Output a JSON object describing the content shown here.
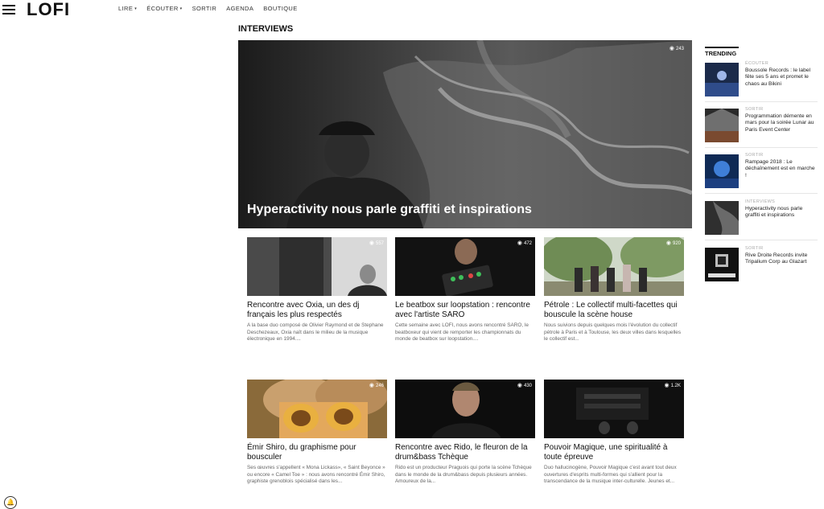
{
  "header": {
    "logo": "LOFI",
    "nav": [
      {
        "label": "LIRE",
        "has_dropdown": true
      },
      {
        "label": "ÉCOUTER",
        "has_dropdown": true
      },
      {
        "label": "SORTIR",
        "has_dropdown": false
      },
      {
        "label": "AGENDA",
        "has_dropdown": false
      },
      {
        "label": "BOUTIQUE",
        "has_dropdown": false
      }
    ],
    "caret": "▾"
  },
  "section_title": "INTERVIEWS",
  "hero": {
    "title": "Hyperactivity nous parle graffiti et inspirations",
    "views": "243"
  },
  "cards": [
    {
      "title": "Rencontre avec Oxia, un des dj français les plus respectés",
      "excerpt": "A la base duo composé de Olivier Raymond et de Stephane Deschezeaux, Oxia naît dans le milieu de la musique électronique en 1994....",
      "views": "557"
    },
    {
      "title": "Le beatbox sur loopstation : rencontre avec l'artiste SARO",
      "excerpt": "Cette semaine avec LOFI, nous avons rencontré SARO, le beatboxeur qui vient de remporter les championnats du monde de beatbox sur loopstation....",
      "views": "472"
    },
    {
      "title": "Pétrole : Le collectif multi-facettes qui bouscule la scène house",
      "excerpt": "Nous suivions depuis quelques mois l'évolution du collectif pétrole à Paris et à Toulouse, les deux villes dans lesquelles le collectif est...",
      "views": "920"
    },
    {
      "title": "Émir Shiro, du graphisme pour bousculer",
      "excerpt": "Ses œuvres s'appellent « Mona Lickass», « Saint Beyonce » ou encore « Camel Toe » : nous avons rencontré Émir Shiro, graphiste grenoblois spécialisé dans les...",
      "views": "246"
    },
    {
      "title": "Rencontre avec Rido, le fleuron de la drum&bass Tchèque",
      "excerpt": "Rido est un producteur Praguois qui porte la scène Tchèque dans le monde de la drum&bass depuis plusieurs années. Amoureux de la...",
      "views": "430"
    },
    {
      "title": "Pouvoir Magique, une spiritualité à toute épreuve",
      "excerpt": "Duo hallucinogène, Pouvoir Magique c'est avant tout deux ouvertures d'esprits multi-formes qui s'allient pour la transcendance de la musique inter-culturelle. Jeunes et...",
      "views": "1.2K"
    }
  ],
  "trending": {
    "title": "TRENDING",
    "items": [
      {
        "category": "ÉCOUTER",
        "text": "Boussole Records : le label fête ses 5 ans et promet le chaos au Bikini"
      },
      {
        "category": "SORTIR",
        "text": "Programmation démente en mars pour la soirée Lunar au Paris Event Center"
      },
      {
        "category": "SORTIR",
        "text": "Rampage 2018 : Le déchaînement est en marche !"
      },
      {
        "category": "INTERVIEWS",
        "text": "Hyperactivity nous parle graffiti et inspirations"
      },
      {
        "category": "SORTIR",
        "text": "Rive Droite Records invite Tripalium Corp au Glazart"
      }
    ]
  },
  "icons": {
    "eye": "◉",
    "bell": "🔔"
  }
}
